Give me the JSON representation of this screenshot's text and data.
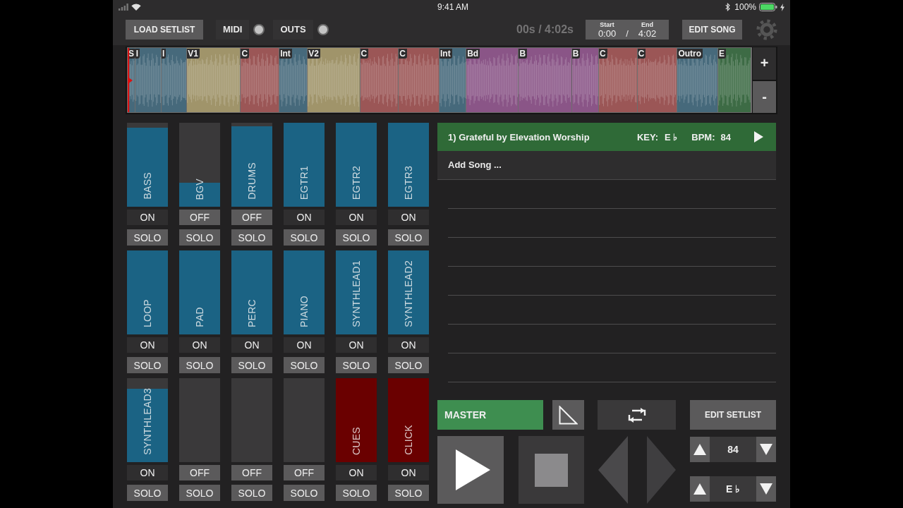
{
  "status_bar": {
    "time": "9:41 AM",
    "battery": "100%"
  },
  "toolbar": {
    "load_button": "LOAD SETLIST",
    "toggles": [
      {
        "label": "MIDI",
        "on": false
      },
      {
        "label": "OUTS",
        "on": false
      }
    ],
    "elapsed": "00s / 4:02s",
    "range": {
      "start_label": "Start",
      "start": "0:00",
      "separator": "/",
      "end_label": "End",
      "end": "4:02"
    },
    "edit_button": "EDIT SONG"
  },
  "timeline": {
    "sections": [
      {
        "label": "S",
        "color": "#46697b"
      },
      {
        "label": "I",
        "color": "#46697b"
      },
      {
        "label": "I",
        "color": "#46697b"
      },
      {
        "label": "V1",
        "color": "#a0946a"
      },
      {
        "label": "C",
        "color": "#9b5656"
      },
      {
        "label": "Int",
        "color": "#46697b"
      },
      {
        "label": "V2",
        "color": "#a0946a"
      },
      {
        "label": "C",
        "color": "#9b5656"
      },
      {
        "label": "C",
        "color": "#9b5656"
      },
      {
        "label": "Int",
        "color": "#46697b"
      },
      {
        "label": "Bd",
        "color": "#8a5587"
      },
      {
        "label": "B",
        "color": "#8a5587"
      },
      {
        "label": "B",
        "color": "#8a5587"
      },
      {
        "label": "C",
        "color": "#9b5656"
      },
      {
        "label": "C",
        "color": "#9b5656"
      },
      {
        "label": "Outro",
        "color": "#46697b"
      },
      {
        "label": "E",
        "color": "#3d6b45"
      }
    ],
    "zoom_in": "+",
    "zoom_out": "-"
  },
  "channels": [
    {
      "name": "BASS",
      "level": 0.94,
      "color": "#1b6384",
      "state_label": "ON",
      "on": true,
      "solo_label": "SOLO",
      "solo": false
    },
    {
      "name": "BGV",
      "level": 0.29,
      "color": "#1b6384",
      "state_label": "OFF",
      "on": false,
      "solo_label": "SOLO",
      "solo": false
    },
    {
      "name": "DRUMS",
      "level": 0.96,
      "color": "#1b6384",
      "state_label": "OFF",
      "on": false,
      "solo_label": "SOLO",
      "solo": false
    },
    {
      "name": "EGTR1",
      "level": 1,
      "color": "#1b6384",
      "state_label": "ON",
      "on": true,
      "solo_label": "SOLO",
      "solo": false
    },
    {
      "name": "EGTR2",
      "level": 1,
      "color": "#1b6384",
      "state_label": "ON",
      "on": true,
      "solo_label": "SOLO",
      "solo": false
    },
    {
      "name": "EGTR3",
      "level": 1,
      "color": "#1b6384",
      "state_label": "ON",
      "on": true,
      "solo_label": "SOLO",
      "solo": false
    },
    {
      "name": "LOOP",
      "level": 1,
      "color": "#1b6384",
      "state_label": "ON",
      "on": true,
      "solo_label": "SOLO",
      "solo": false
    },
    {
      "name": "PAD",
      "level": 1,
      "color": "#1b6384",
      "state_label": "ON",
      "on": true,
      "solo_label": "SOLO",
      "solo": false
    },
    {
      "name": "PERC",
      "level": 1,
      "color": "#1b6384",
      "state_label": "ON",
      "on": true,
      "solo_label": "SOLO",
      "solo": false
    },
    {
      "name": "PIANO",
      "level": 1,
      "color": "#1b6384",
      "state_label": "ON",
      "on": true,
      "solo_label": "SOLO",
      "solo": false
    },
    {
      "name": "SYNTHLEAD1",
      "level": 1,
      "color": "#1b6384",
      "state_label": "ON",
      "on": true,
      "solo_label": "SOLO",
      "solo": false
    },
    {
      "name": "SYNTHLEAD2",
      "level": 1,
      "color": "#1b6384",
      "state_label": "ON",
      "on": true,
      "solo_label": "SOLO",
      "solo": false
    },
    {
      "name": "SYNTHLEAD3",
      "level": 0.87,
      "color": "#1b6384",
      "state_label": "ON",
      "on": true,
      "solo_label": "SOLO",
      "solo": false
    },
    {
      "state_label": "OFF",
      "on": false,
      "solo_label": "SOLO",
      "solo": false
    },
    {
      "state_label": "OFF",
      "on": false,
      "solo_label": "SOLO",
      "solo": false
    },
    {
      "state_label": "OFF",
      "on": false,
      "solo_label": "SOLO",
      "solo": false
    },
    {
      "name": "CUES",
      "level": 1,
      "color": "#6a0000",
      "state_label": "ON",
      "on": true,
      "solo_label": "SOLO",
      "solo": false
    },
    {
      "name": "CLICK",
      "level": 1,
      "color": "#6a0000",
      "state_label": "ON",
      "on": true,
      "solo_label": "SOLO",
      "solo": false
    }
  ],
  "setlist": {
    "songs": [
      {
        "title": "1) Grateful by Elevation Worship",
        "key_label": "KEY:",
        "key": "E ♭",
        "bpm_label": "BPM:",
        "bpm": "84",
        "selected": true
      }
    ],
    "add_song": "Add Song ..."
  },
  "controls": {
    "master": "MASTER",
    "master_on": true,
    "loop_on": false,
    "edit_setlist": "EDIT SETLIST",
    "steppers": [
      {
        "value": "84"
      },
      {
        "value": "E ♭"
      }
    ]
  }
}
